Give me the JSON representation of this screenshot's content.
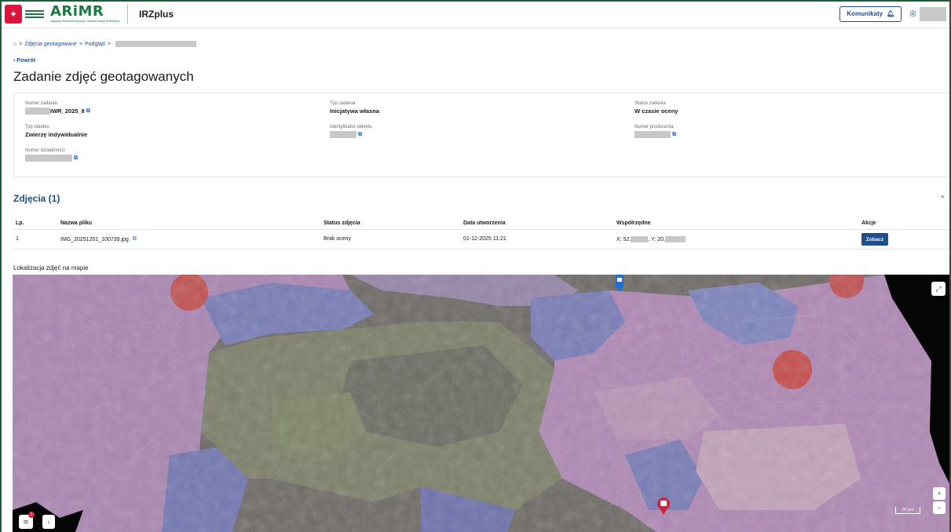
{
  "header": {
    "logo_text": "ARiMR",
    "logo_subtitle": "Agencja Restrukturyzacji i Modernizacji Rolnictwa",
    "app_name": "IRZplus",
    "komunikaty_label": "Komunikaty",
    "bell_icon": "bell-icon",
    "user_icon": "user-icon"
  },
  "breadcrumb": {
    "home_icon": "home-icon",
    "items": [
      "Zdjęcia geotagowane",
      "Podgląd"
    ],
    "separator": ">"
  },
  "back_label": "Powrót",
  "page_title": "Zadanie zdjęć geotagowanych",
  "details": {
    "numer_zadania": {
      "label": "Numer zadania",
      "value": "IWR_2025_8"
    },
    "typ_zadania": {
      "label": "Typ zadania",
      "value": "Inicjatywa własna"
    },
    "status_zadania": {
      "label": "Status zadania",
      "value": "W czasie oceny"
    },
    "typ_obiektu": {
      "label": "Typ obiektu",
      "value": "Zwierzę indywidualnie"
    },
    "identyfikator_obiektu": {
      "label": "Identyfikator obiektu",
      "value": ""
    },
    "numer_producenta": {
      "label": "Numer producenta",
      "value": ""
    },
    "numer_dzialalnosci": {
      "label": "Numer działalności",
      "value": ""
    }
  },
  "photos": {
    "title": "Zdjęcia (1)",
    "columns": [
      "Lp.",
      "Nazwa pliku",
      "Status zdjęcia",
      "Data utworzenia",
      "Współrzędne",
      "Akcje"
    ],
    "rows": [
      {
        "lp": "1",
        "filename": "IMG_20251201_100739.jpg",
        "status": "Brak oceny",
        "date": "01-12-2025 11:21",
        "coord_x_prefix": "X: 52.",
        "coord_y_prefix": ", Y: 20.",
        "action": "Zobacz"
      }
    ]
  },
  "map": {
    "label": "Lokalizacja zdjęć na mapie",
    "scale_label": "20 km",
    "zoom_in": "+",
    "zoom_out": "−",
    "layers_badge": "1",
    "colors": {
      "purple_region": "#b07cc0",
      "blue_region": "#6c78c8",
      "red_region": "#d93030",
      "marker_blue": "#1f6fd1",
      "marker_red": "#d4213d"
    }
  }
}
